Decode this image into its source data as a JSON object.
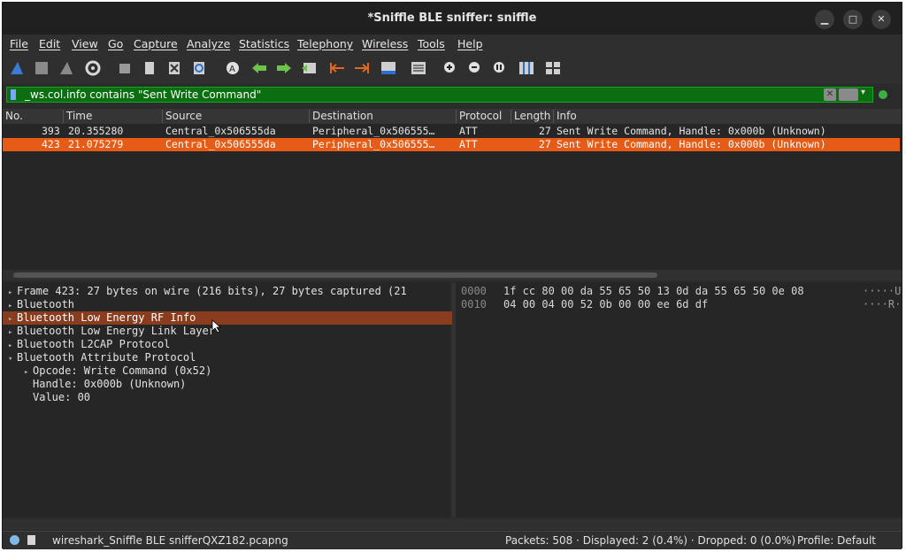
{
  "window": {
    "title": "*Sniffle BLE sniffer: sniffle",
    "controls": [
      "minimize-icon",
      "maximize-icon",
      "close-icon"
    ]
  },
  "menu": [
    "File",
    "Edit",
    "View",
    "Go",
    "Capture",
    "Analyze",
    "Statistics",
    "Telephony",
    "Wireless",
    "Tools",
    "Help"
  ],
  "toolbar_icons": [
    "shark-fin-start-icon",
    "stop-square-icon",
    "restart-fin-icon",
    "options-gear-icon",
    "open-folder-icon",
    "save-file-icon",
    "close-file-icon",
    "reload-icon",
    "find-packet-icon",
    "go-back-arrow-icon",
    "go-forward-arrow-icon",
    "go-to-packet-icon",
    "first-packet-icon",
    "last-packet-icon",
    "auto-scroll-icon",
    "colorize-icon",
    "zoom-in-icon",
    "zoom-out-icon",
    "normal-size-icon",
    "resize-columns-icon",
    "layout-grid-icon"
  ],
  "filter": {
    "value": "_ws.col.info contains \"Sent Write Command\"",
    "bg_color": "#0b6e11"
  },
  "packet_list": {
    "columns": [
      "No.",
      "Time",
      "Source",
      "Destination",
      "Protocol",
      "Length",
      "Info"
    ],
    "rows": [
      {
        "no": "393",
        "time": "20.355280",
        "source": "Central_0x506555da",
        "destination": "Peripheral_0x506555…",
        "protocol": "ATT",
        "length": "27",
        "info": "Sent Write Command, Handle: 0x000b (Unknown)",
        "selected": false
      },
      {
        "no": "423",
        "time": "21.075279",
        "source": "Central_0x506555da",
        "destination": "Peripheral_0x506555…",
        "protocol": "ATT",
        "length": "27",
        "info": "Sent Write Command, Handle: 0x000b (Unknown)",
        "selected": true
      }
    ],
    "selected_color": "#e65c17"
  },
  "details": [
    {
      "text": "Frame 423: 27 bytes on wire (216 bits), 27 bytes captured (21",
      "indent": 0,
      "arrow": "▸",
      "selected": false
    },
    {
      "text": "Bluetooth",
      "indent": 0,
      "arrow": "▸",
      "selected": false
    },
    {
      "text": "Bluetooth Low Energy RF Info",
      "indent": 0,
      "arrow": "▸",
      "selected": true
    },
    {
      "text": "Bluetooth Low Energy Link Layer",
      "indent": 0,
      "arrow": "▸",
      "selected": false
    },
    {
      "text": "Bluetooth L2CAP Protocol",
      "indent": 0,
      "arrow": "▸",
      "selected": false
    },
    {
      "text": "Bluetooth Attribute Protocol",
      "indent": 0,
      "arrow": "▾",
      "selected": false
    },
    {
      "text": "Opcode: Write Command (0x52)",
      "indent": 1,
      "arrow": "▸",
      "selected": false
    },
    {
      "text": "Handle: 0x000b (Unknown)",
      "indent": 1,
      "arrow": "",
      "selected": false
    },
    {
      "text": "Value: 00",
      "indent": 1,
      "arrow": "",
      "selected": false
    }
  ],
  "bytes": [
    {
      "offset": "0000",
      "hex": "1f cc 80 00 da 55 65 50  13 0d da 55 65 50 0e 08",
      "ascii": "·····U"
    },
    {
      "offset": "0010",
      "hex": "04 00 04 00 52 0b 00 00  ee 6d df",
      "ascii": "····R·"
    }
  ],
  "status": {
    "file": "wireshark_Sniffle BLE snifferQXZ182.pcapng",
    "packets": "Packets: 508 · Displayed: 2 (0.4%) · Dropped: 0 (0.0%)",
    "profile": "Profile: Default"
  }
}
